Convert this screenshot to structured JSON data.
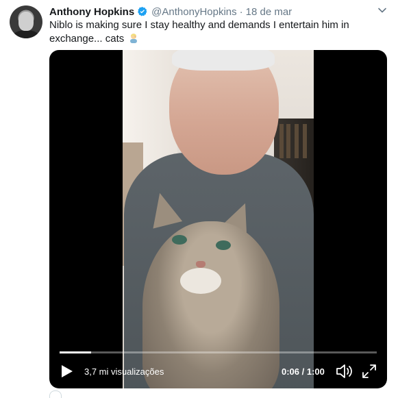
{
  "tweet": {
    "author_name": "Anthony Hopkins",
    "handle": "@AnthonyHopkins",
    "separator": "·",
    "date": "18 de mar",
    "text": "Niblo is making sure I stay healthy and demands I entertain him in exchange... cats",
    "emoji_icon": "person-facepalm-emoji-icon",
    "verified_icon": "verified-badge-icon",
    "menu_icon": "chevron-down-icon"
  },
  "video": {
    "progress_fraction": 0.1,
    "views": "3,7 mi visualizações",
    "time": "0:06 / 1:00",
    "icons": {
      "play": "play-icon",
      "volume": "volume-icon",
      "fullscreen": "fullscreen-icon"
    }
  },
  "colors": {
    "text": "#14171a",
    "secondary": "#657786",
    "verified": "#1da1f2",
    "video_bg": "#000000"
  }
}
